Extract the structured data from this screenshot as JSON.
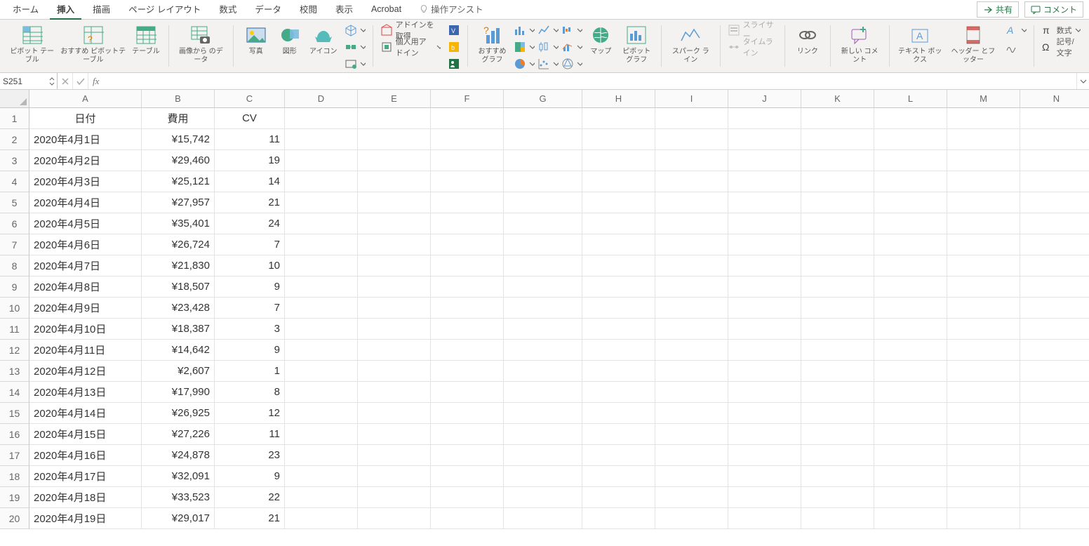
{
  "tabs": {
    "home": "ホーム",
    "insert": "挿入",
    "draw": "描画",
    "pagelayout": "ページ レイアウト",
    "formulas": "数式",
    "data": "データ",
    "review": "校閲",
    "view": "表示",
    "acrobat": "Acrobat",
    "tellme": "操作アシスト"
  },
  "topright": {
    "share": "共有",
    "comments": "コメント"
  },
  "ribbon": {
    "pivot": "ピボット\nテーブル",
    "recpivot": "おすすめ\nピボットテーブル",
    "table": "テーブル",
    "picfromdata": "画像から\nのデータ",
    "pictures": "写真",
    "shapes": "図形",
    "icons": "アイコン",
    "getaddins": "アドインを取得",
    "myaddins": "個人用アドイン",
    "reccharts": "おすすめ\nグラフ",
    "maps": "マップ",
    "pivotchart": "ピボット\nグラフ",
    "sparklines": "スパーク\nライン",
    "slicer": "スライサー",
    "timeline": "タイムライン",
    "link": "リンク",
    "comment": "新しい\nコメント",
    "textbox": "テキスト\nボックス",
    "headerfooter": "ヘッダー\nとフッター",
    "equation": "数式",
    "symbol": "記号/文字"
  },
  "namebox": "S251",
  "columns": [
    {
      "l": "A",
      "w": 160
    },
    {
      "l": "B",
      "w": 104
    },
    {
      "l": "C",
      "w": 100
    },
    {
      "l": "D",
      "w": 104
    },
    {
      "l": "E",
      "w": 104
    },
    {
      "l": "F",
      "w": 104
    },
    {
      "l": "G",
      "w": 112
    },
    {
      "l": "H",
      "w": 104
    },
    {
      "l": "I",
      "w": 104
    },
    {
      "l": "J",
      "w": 104
    },
    {
      "l": "K",
      "w": 104
    },
    {
      "l": "L",
      "w": 104
    },
    {
      "l": "M",
      "w": 104
    },
    {
      "l": "N",
      "w": 104
    }
  ],
  "headers": [
    "日付",
    "費用",
    "CV"
  ],
  "rows": [
    {
      "date": "2020年4月1日",
      "cost": "¥15,742",
      "cv": "11"
    },
    {
      "date": "2020年4月2日",
      "cost": "¥29,460",
      "cv": "19"
    },
    {
      "date": "2020年4月3日",
      "cost": "¥25,121",
      "cv": "14"
    },
    {
      "date": "2020年4月4日",
      "cost": "¥27,957",
      "cv": "21"
    },
    {
      "date": "2020年4月5日",
      "cost": "¥35,401",
      "cv": "24"
    },
    {
      "date": "2020年4月6日",
      "cost": "¥26,724",
      "cv": "7"
    },
    {
      "date": "2020年4月7日",
      "cost": "¥21,830",
      "cv": "10"
    },
    {
      "date": "2020年4月8日",
      "cost": "¥18,507",
      "cv": "9"
    },
    {
      "date": "2020年4月9日",
      "cost": "¥23,428",
      "cv": "7"
    },
    {
      "date": "2020年4月10日",
      "cost": "¥18,387",
      "cv": "3"
    },
    {
      "date": "2020年4月11日",
      "cost": "¥14,642",
      "cv": "9"
    },
    {
      "date": "2020年4月12日",
      "cost": "¥2,607",
      "cv": "1"
    },
    {
      "date": "2020年4月13日",
      "cost": "¥17,990",
      "cv": "8"
    },
    {
      "date": "2020年4月14日",
      "cost": "¥26,925",
      "cv": "12"
    },
    {
      "date": "2020年4月15日",
      "cost": "¥27,226",
      "cv": "11"
    },
    {
      "date": "2020年4月16日",
      "cost": "¥24,878",
      "cv": "23"
    },
    {
      "date": "2020年4月17日",
      "cost": "¥32,091",
      "cv": "9"
    },
    {
      "date": "2020年4月18日",
      "cost": "¥33,523",
      "cv": "22"
    },
    {
      "date": "2020年4月19日",
      "cost": "¥29,017",
      "cv": "21"
    }
  ]
}
